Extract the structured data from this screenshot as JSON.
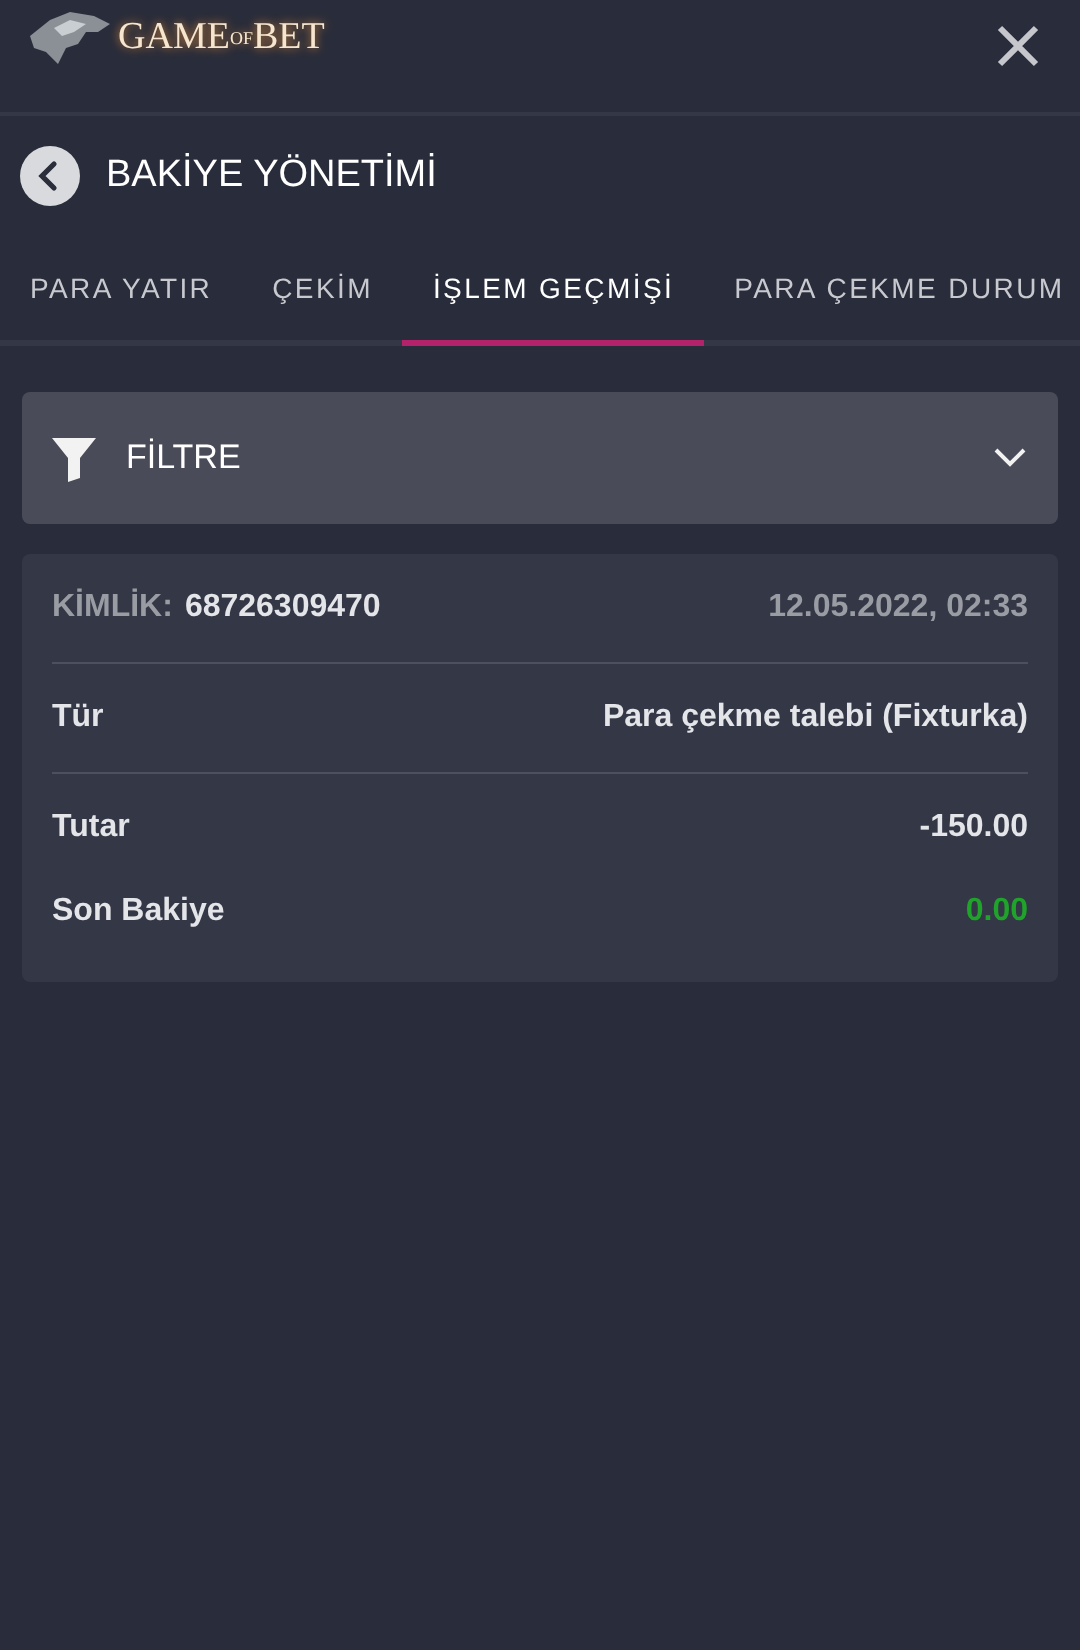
{
  "logo": {
    "parts": [
      {
        "text": "GAME",
        "kind": "large"
      },
      {
        "text": "OF",
        "kind": "small"
      },
      {
        "text": "BET",
        "kind": "large"
      }
    ]
  },
  "page_title": "BAKİYE YÖNETİMİ",
  "tabs": [
    {
      "label": "PARA YATIR",
      "selected": false
    },
    {
      "label": "ÇEKİM",
      "selected": false
    },
    {
      "label": "İŞLEM GEÇMİŞİ",
      "selected": true
    },
    {
      "label": "PARA ÇEKME DURUM",
      "selected": false
    }
  ],
  "filter": {
    "label": "FİLTRE",
    "expanded": false
  },
  "transaction": {
    "id_label": "KİMLİK:",
    "id": "68726309470",
    "date": "12.05.2022, 02:33",
    "rows": [
      {
        "label": "Tür",
        "value": "Para çekme talebi (Fixturka)",
        "color": "#e4e5e9",
        "divider_after": true
      },
      {
        "label": "Tutar",
        "value": "-150.00",
        "color": "#e4e5e9",
        "divider_after": false
      },
      {
        "label": "Son Bakiye",
        "value": "0.00",
        "color": "#1fa32a",
        "divider_after": false
      }
    ]
  }
}
